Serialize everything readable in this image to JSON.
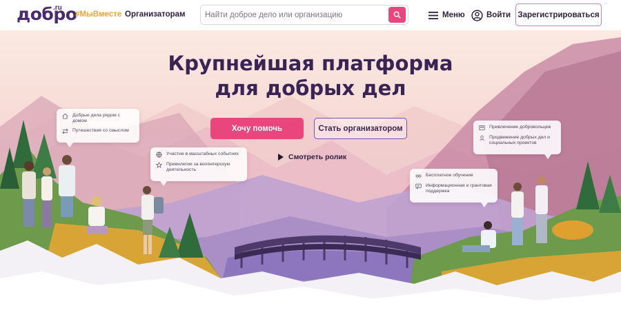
{
  "header": {
    "logo_text": "добро",
    "logo_tld": ".ru",
    "hashtag_link": "#МыВместе",
    "organizers_link": "Организаторам",
    "search_placeholder": "Найти доброе дело или организацию",
    "menu_label": "Меню",
    "login_label": "Войти",
    "register_label": "Зарегистрироваться"
  },
  "hero": {
    "headline_line1": "Крупнейшая платформа",
    "headline_line2": "для добрых дел",
    "primary_button": "Хочу помочь",
    "secondary_button": "Стать организатором",
    "watch_video": "Смотреть ролик"
  },
  "cards": {
    "card1": {
      "item1": "Добрые дела рядом с домом",
      "item2": "Путешествия со смыслом",
      "icon1": "home-icon",
      "icon2": "arrows-icon"
    },
    "card2": {
      "item1": "Участие в масштабных событиях",
      "item2": "Привилегии за волонтерскую деятельность",
      "icon1": "globe-icon",
      "icon2": "star-icon"
    },
    "card3": {
      "item1": "Привлечение добровольцев",
      "item2": "Продвижение добрых дел и социальных проектов",
      "icon1": "people-icon",
      "icon2": "megaphone-icon"
    },
    "card4": {
      "item1": "Бесплатное обучение",
      "item2": "Информационная и грантовая поддержка",
      "icon1": "glasses-icon",
      "icon2": "chat-icon"
    }
  },
  "colors": {
    "brand_purple": "#4a2a72",
    "accent_pink": "#e8467c",
    "accent_orange": "#f0a536",
    "outline_violet": "#6b55b8"
  }
}
